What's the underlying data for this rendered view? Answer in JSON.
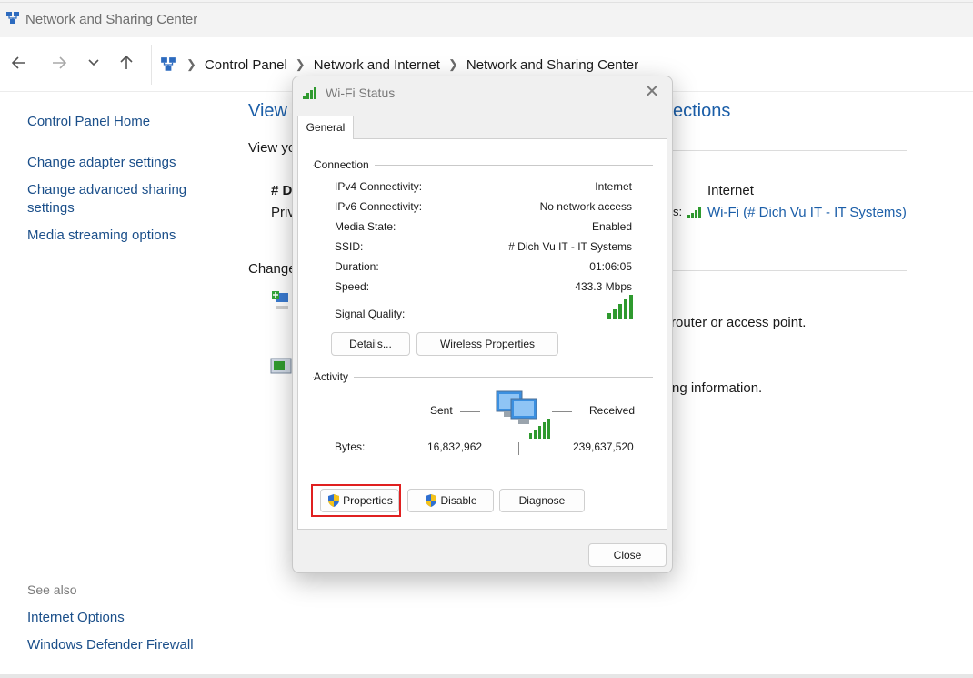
{
  "window": {
    "title": "Network and Sharing Center"
  },
  "nav": {
    "back_icon": "arrow-left-icon",
    "forward_icon": "arrow-right-icon",
    "recent_icon": "chevron-down-icon",
    "up_icon": "arrow-up-icon",
    "breadcrumb": [
      "Control Panel",
      "Network and Internet",
      "Network and Sharing Center"
    ]
  },
  "sidebar": {
    "home": "Control Panel Home",
    "items": [
      "Change adapter settings",
      "Change advanced sharing",
      "settings",
      "Media streaming options"
    ],
    "see_also_label": "See also",
    "see_also_items": [
      "Internet Options",
      "Windows Defender Firewall"
    ]
  },
  "background": {
    "heading_left": "View y",
    "heading_right": "ections",
    "subtitle": "View yo",
    "network_name_partial": "# D",
    "network_type_partial": "Priv",
    "access_type": "Internet",
    "connections_label_partial": "s:",
    "connection_link": "Wi-Fi (# Dich Vu IT - IT Systems)",
    "change_label_partial": "Change",
    "text_router": "router or access point.",
    "text_sharing": "ng information."
  },
  "dialog": {
    "title": "Wi-Fi Status",
    "tab": "General",
    "connection_label": "Connection",
    "rows": [
      {
        "label": "IPv4 Connectivity:",
        "value": "Internet"
      },
      {
        "label": "IPv6 Connectivity:",
        "value": "No network access"
      },
      {
        "label": "Media State:",
        "value": "Enabled"
      },
      {
        "label": "SSID:",
        "value": "# Dich Vu IT - IT Systems"
      },
      {
        "label": "Duration:",
        "value": "01:06:05"
      },
      {
        "label": "Speed:",
        "value": "433.3 Mbps"
      }
    ],
    "signal_label": "Signal Quality:",
    "signal_bars": 5,
    "details_button": "Details...",
    "wireless_button": "Wireless Properties",
    "activity_label": "Activity",
    "sent_label": "Sent",
    "received_label": "Received",
    "bytes_label": "Bytes:",
    "bytes_sent": "16,832,962",
    "bytes_received": "239,637,520",
    "properties_button": "Properties",
    "disable_button": "Disable",
    "diagnose_button": "Diagnose",
    "close_button": "Close"
  },
  "colors": {
    "link": "#1b4f8a",
    "heading": "#1b5ea8",
    "highlight": "#e02020",
    "signal_green": "#2f9a2f"
  }
}
